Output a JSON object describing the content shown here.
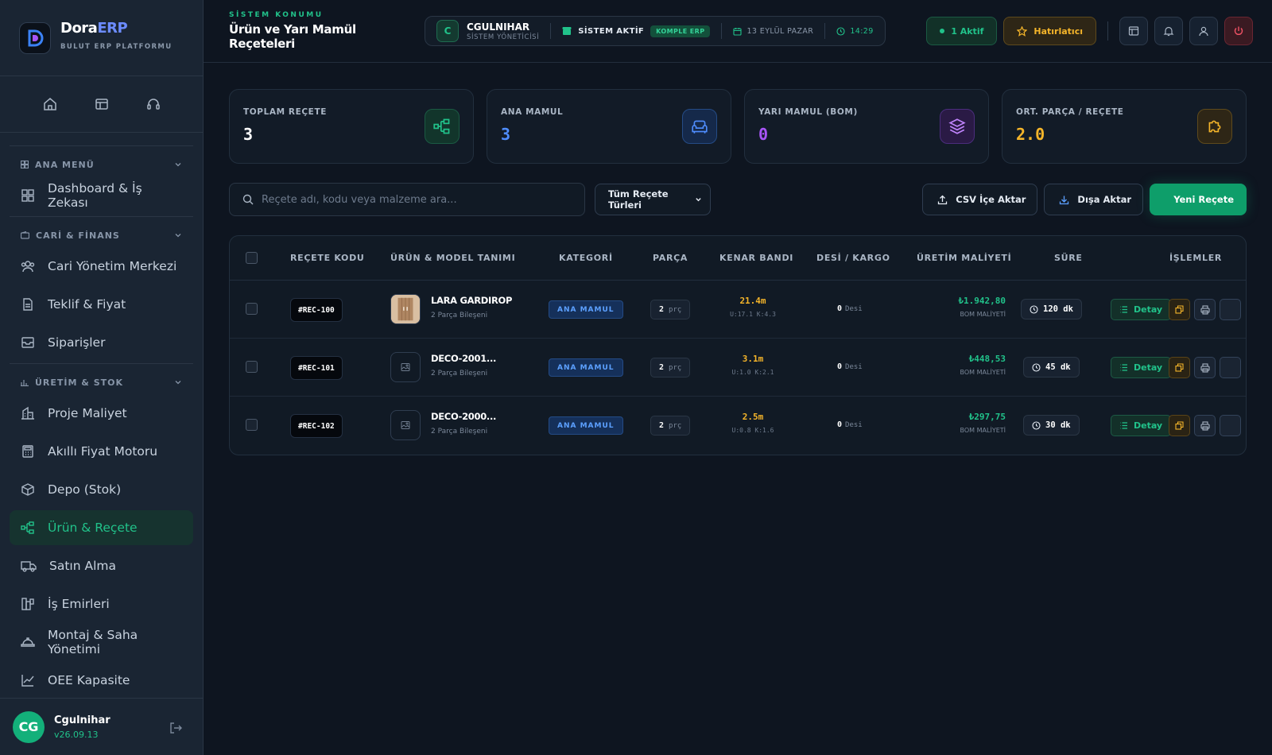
{
  "brand": {
    "name_main": "Dora",
    "name_accent": "ERP",
    "subtitle": "BULUT ERP PLATFORMU"
  },
  "sidebar": {
    "quick_icons": [
      "home-icon",
      "layout-icon",
      "headset-icon"
    ],
    "groups": [
      {
        "label": "ANA MENÜ",
        "icon": "grid-icon",
        "items": [
          {
            "label": "Dashboard & İş Zekası",
            "icon": "dashboard-icon"
          }
        ]
      },
      {
        "label": "CARİ & FİNANS",
        "icon": "wallet-icon",
        "items": [
          {
            "label": "Cari Yönetim Merkezi",
            "icon": "users-icon"
          },
          {
            "label": "Teklif & Fiyat",
            "icon": "document-icon"
          },
          {
            "label": "Siparişler",
            "icon": "inbox-icon"
          }
        ]
      },
      {
        "label": "ÜRETİM & STOK",
        "icon": "bar-icon",
        "items": [
          {
            "label": "Proje Maliyet",
            "icon": "building-icon"
          },
          {
            "label": "Akıllı Fiyat Motoru",
            "icon": "calculator-icon"
          },
          {
            "label": "Depo (Stok)",
            "icon": "box-icon"
          },
          {
            "label": "Ürün & Reçete",
            "icon": "hierarchy-icon",
            "active": true
          },
          {
            "label": "Satın Alma",
            "icon": "truck-icon"
          },
          {
            "label": "İş Emirleri",
            "icon": "blocks-icon"
          },
          {
            "label": "Montaj & Saha Yönetimi",
            "icon": "helmet-icon"
          },
          {
            "label": "OEE Kapasite",
            "icon": "chart-icon"
          }
        ]
      }
    ]
  },
  "user": {
    "initials": "CG",
    "name": "Cgulnihar",
    "version": "v26.09.13"
  },
  "header": {
    "kicker": "SİSTEM KONUMU",
    "title": "Ürün ve Yarı Mamül Reçeteleri",
    "status": {
      "badge": "C",
      "user": "CGULNIHAR",
      "role": "SİSTEM YÖNETİCİSİ",
      "system": "SİSTEM AKTİF",
      "tag": "KOMPLE ERP",
      "date": "13 EYLÜL PAZAR",
      "time": "14:29"
    },
    "active_label": "1 Aktif",
    "reminder_label": "Hatırlatıcı"
  },
  "stats": [
    {
      "label": "TOPLAM REÇETE",
      "value": "3",
      "color": "#ffffff",
      "icon": "hierarchy-icon"
    },
    {
      "label": "ANA MAMUL",
      "value": "3",
      "color": "#4f8dff",
      "icon": "sofa-icon"
    },
    {
      "label": "YARI MAMUL (BOM)",
      "value": "0",
      "color": "#a855f7",
      "icon": "layers-icon"
    },
    {
      "label": "ORT. PARÇA / REÇETE",
      "value": "2.0",
      "color": "#f5b52a",
      "icon": "puzzle-icon"
    }
  ],
  "toolbar": {
    "search_placeholder": "Reçete adı, kodu veya malzeme ara...",
    "filter_value": "Tüm Reçete Türleri",
    "import_label": "CSV İçe Aktar",
    "export_label": "Dışa Aktar",
    "new_label": "Yeni Reçete"
  },
  "table": {
    "headers": [
      "REÇETE KODU",
      "ÜRÜN & MODEL TANIMI",
      "KATEGORİ",
      "PARÇA",
      "KENAR BANDI",
      "DESİ / KARGO",
      "ÜRETİM MALİYETİ",
      "SÜRE",
      "İŞLEMLER"
    ],
    "rows": [
      {
        "code": "#REC-100",
        "name": "LARA GARDIROP",
        "sub": "2 Parça Bileşeni",
        "has_image": true,
        "category": "ANA MAMUL",
        "parts": "2",
        "parts_unit": "prç",
        "edge": "21.4m",
        "edge_sub": "U:17.1 K:4.3",
        "desi": "0",
        "desi_unit": "Desi",
        "cost": "₺1.942,80",
        "cost_sub": "BOM MALİYETİ",
        "duration": "120 dk",
        "detail_label": "Detay"
      },
      {
        "code": "#REC-101",
        "name": "DECO-2001...",
        "sub": "2 Parça Bileşeni",
        "has_image": false,
        "category": "ANA MAMUL",
        "parts": "2",
        "parts_unit": "prç",
        "edge": "3.1m",
        "edge_sub": "U:1.0 K:2.1",
        "desi": "0",
        "desi_unit": "Desi",
        "cost": "₺448,53",
        "cost_sub": "BOM MALİYETİ",
        "duration": "45 dk",
        "detail_label": "Detay"
      },
      {
        "code": "#REC-102",
        "name": "DECO-2000...",
        "sub": "2 Parça Bileşeni",
        "has_image": false,
        "category": "ANA MAMUL",
        "parts": "2",
        "parts_unit": "prç",
        "edge": "2.5m",
        "edge_sub": "U:0.8 K:1.6",
        "desi": "0",
        "desi_unit": "Desi",
        "cost": "₺297,75",
        "cost_sub": "BOM MALİYETİ",
        "duration": "30 dk",
        "detail_label": "Detay"
      }
    ]
  }
}
